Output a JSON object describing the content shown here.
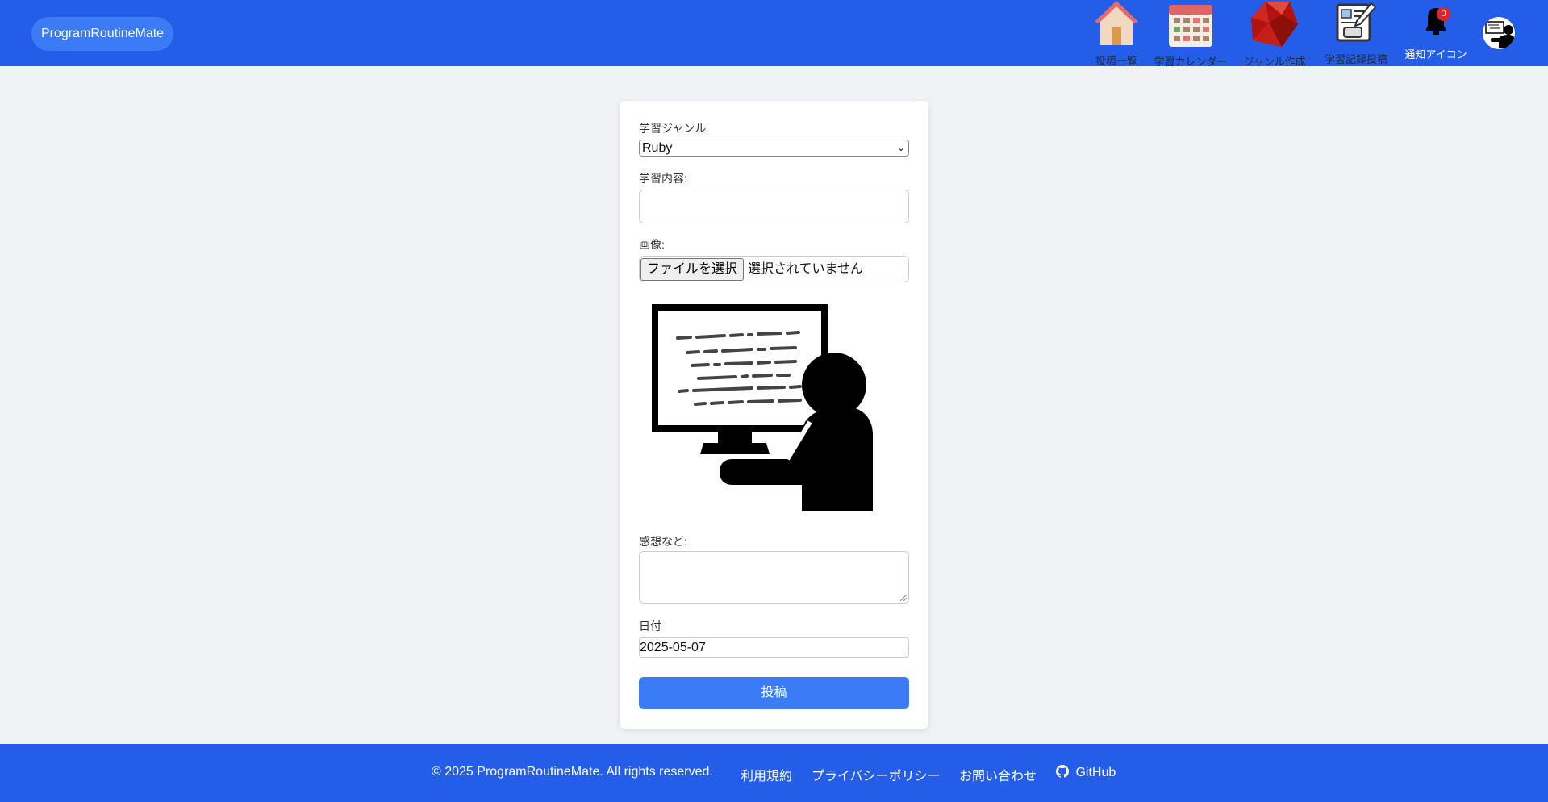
{
  "header": {
    "brand": "ProgramRoutineMate",
    "nav": [
      {
        "label": "投稿一覧",
        "icon": "home-icon"
      },
      {
        "label": "学習カレンダー",
        "icon": "calendar-icon"
      },
      {
        "label": "ジャンル作成",
        "icon": "ruby-gem-icon"
      },
      {
        "label": "学習記録投稿",
        "icon": "post-form-icon"
      },
      {
        "label": "通知アイコン",
        "icon": "bell-icon",
        "badge": "0"
      }
    ],
    "avatar_icon": "avatar-icon"
  },
  "form": {
    "genre_label": "学習ジャンル",
    "genre_value": "Ruby",
    "content_label": "学習内容:",
    "content_value": "",
    "image_label": "画像:",
    "file_button": "ファイルを選択",
    "file_status": "選択されていません",
    "preview_icon": "programmer-at-computer-illustration",
    "impression_label": "感想など:",
    "impression_value": "",
    "date_label": "日付",
    "date_value": "2025-05-07",
    "submit_label": "投稿"
  },
  "footer": {
    "copyright": "© 2025 ProgramRoutineMate. All rights reserved.",
    "links": [
      "利用規約",
      "プライバシーポリシー",
      "お問い合わせ",
      "GitHub"
    ],
    "github_icon": "github-icon"
  },
  "colors": {
    "header_bg": "#245ee8",
    "accent": "#3b7bf5",
    "page_bg": "#f0f2f5",
    "badge": "#e02424"
  }
}
